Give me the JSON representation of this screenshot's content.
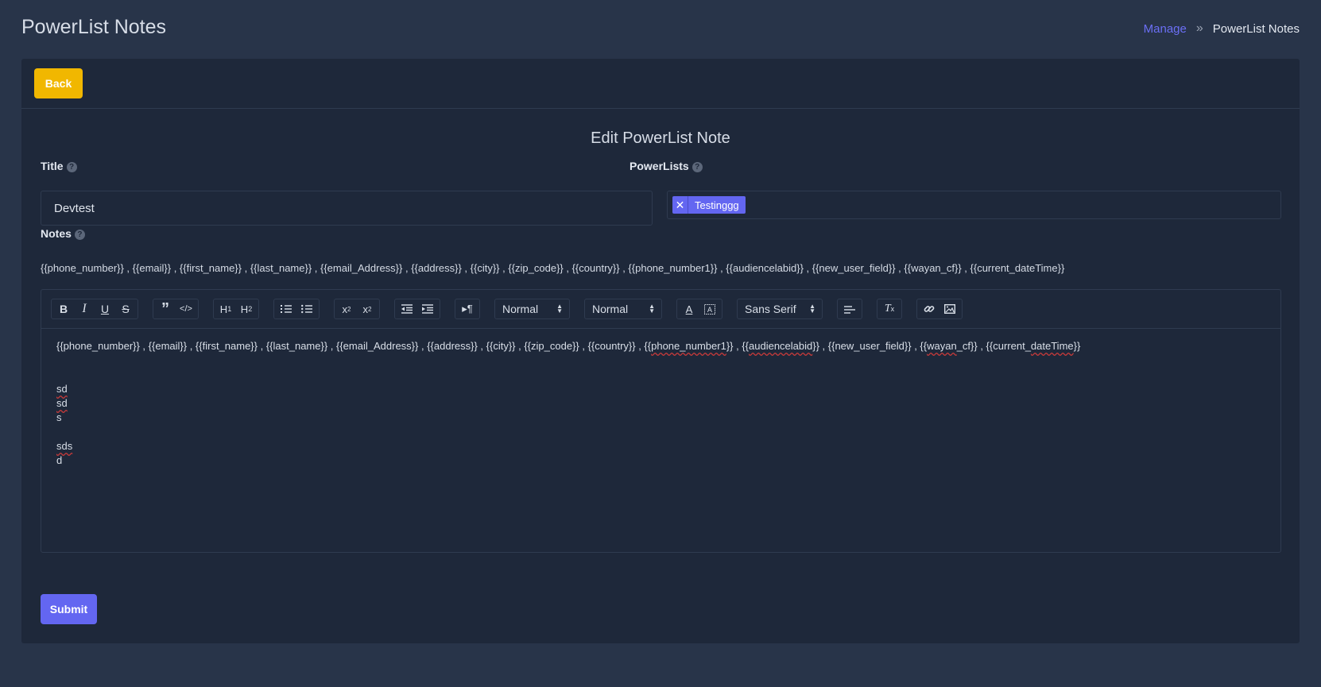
{
  "header": {
    "title": "PowerList Notes",
    "breadcrumb": {
      "link": "Manage",
      "separator": "»",
      "current": "PowerList Notes"
    }
  },
  "card": {
    "back_label": "Back",
    "form_title": "Edit PowerList Note",
    "title_label": "Title",
    "title_value": "Devtest",
    "powerlists_label": "PowerLists",
    "powerlists_tag": "Testinggg",
    "notes_label": "Notes",
    "placeholders": "{{phone_number}} , {{email}} , {{first_name}} , {{last_name}} , {{email_Address}} , {{address}} , {{city}} , {{zip_code}} , {{country}} , {{phone_number1}} , {{audiencelabid}} , {{new_user_field}} , {{wayan_cf}} , {{current_dateTime}}",
    "submit_label": "Submit"
  },
  "toolbar": {
    "header_select": "Normal",
    "size_select": "Normal",
    "font_select": "Sans Serif",
    "icons": [
      "bold-icon",
      "italic-icon",
      "underline-icon",
      "strike-icon",
      "blockquote-icon",
      "code-block-icon",
      "h1-icon",
      "h2-icon",
      "ordered-list-icon",
      "bullet-list-icon",
      "subscript-icon",
      "superscript-icon",
      "outdent-icon",
      "indent-icon",
      "rtl-icon",
      "color-icon",
      "background-icon",
      "align-icon",
      "clean-icon",
      "link-icon",
      "image-icon"
    ]
  },
  "editor": {
    "line1_a": "{{phone_number}} , {{email}} , {{first_name}} , {{last_name}} , {{email_Address}} , {{address}} , {{city}} , {{zip_code}} , {{country}} , {{",
    "line1_b": "phone_number1",
    "line1_c": "}} , {{",
    "line1_d": "audiencelabid",
    "line1_e": "}} , {{new_user_field}} , {{",
    "line1_f": "wayan",
    "line1_g": "_cf}} , {{current_",
    "line1_h": "dateTime",
    "line1_i": "}}",
    "line2": "sd",
    "line3": "sd",
    "line4": "s",
    "line5": "sds",
    "line6": "d"
  }
}
